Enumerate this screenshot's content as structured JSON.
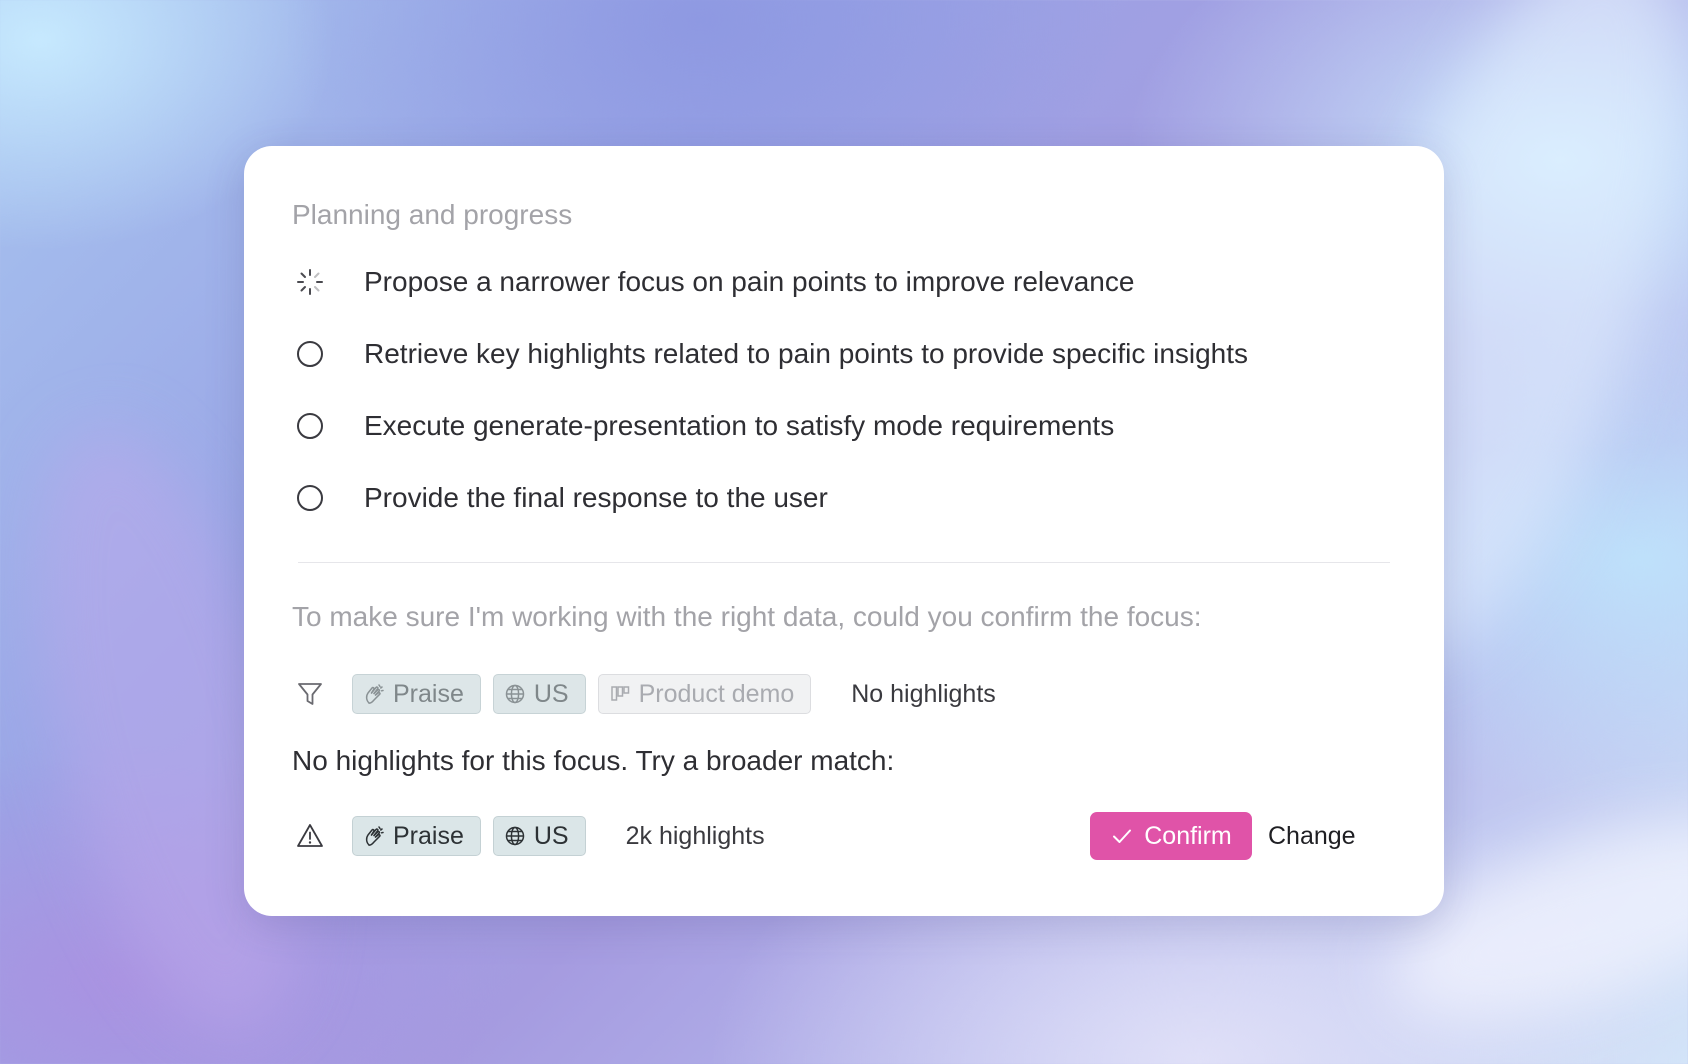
{
  "plan": {
    "title": "Planning and progress",
    "tasks": [
      {
        "label": "Propose a narrower focus on pain points to improve relevance",
        "status": "in-progress",
        "icon": "spinner-icon"
      },
      {
        "label": "Retrieve key highlights related to pain points to provide specific insights",
        "status": "pending",
        "icon": "empty-circle-icon"
      },
      {
        "label": "Execute generate-presentation to satisfy mode requirements",
        "status": "pending",
        "icon": "empty-circle-icon"
      },
      {
        "label": "Provide the final response to the user",
        "status": "pending",
        "icon": "empty-circle-icon"
      }
    ]
  },
  "focus": {
    "prompt": "To make sure I'm working with the right data, could you confirm the focus:",
    "current_filter": {
      "icon": "filter-icon",
      "chips": [
        {
          "label": "Praise",
          "icon": "clapping-hands-icon"
        },
        {
          "label": "US",
          "icon": "globe-icon"
        },
        {
          "label": "Product demo",
          "icon": "board-icon"
        }
      ],
      "count": "No highlights"
    },
    "broader_message": "No highlights for this focus. Try a broader match:",
    "suggested_filter": {
      "icon": "warning-icon",
      "chips": [
        {
          "label": "Praise",
          "icon": "clapping-hands-icon"
        },
        {
          "label": "US",
          "icon": "globe-icon"
        }
      ],
      "count": "2k highlights"
    },
    "actions": {
      "confirm": "Confirm",
      "change": "Change"
    }
  },
  "colors": {
    "accent": "#e053a8",
    "chip_bg": "#dbe6e8",
    "muted_text": "#a3a3a8"
  }
}
